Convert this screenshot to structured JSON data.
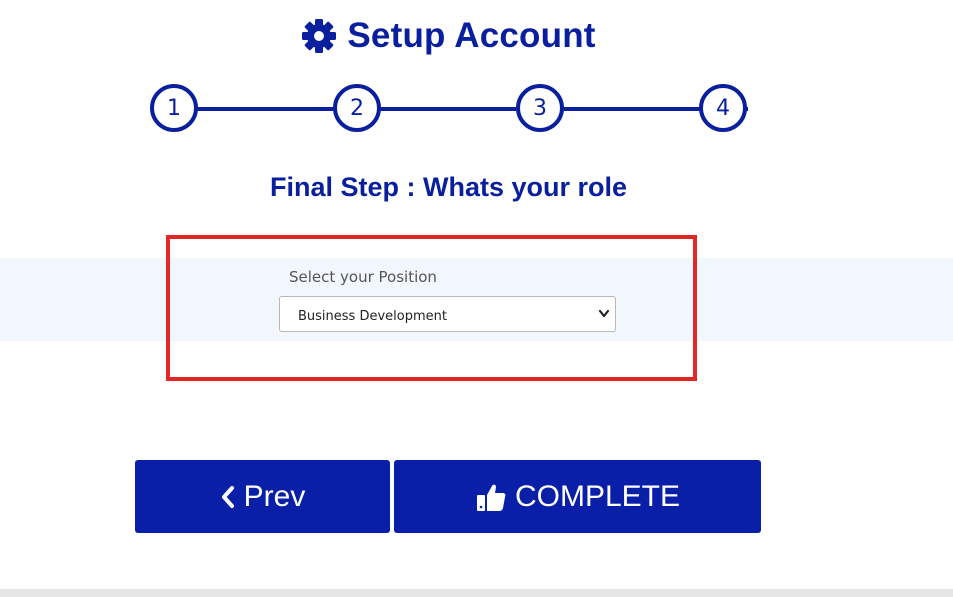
{
  "header": {
    "title": "Setup Account",
    "icon": "gear-icon"
  },
  "stepper": {
    "steps": [
      "1",
      "2",
      "3",
      "4"
    ]
  },
  "subtitle": "Final Step : Whats your role",
  "position_field": {
    "label": "Select your Position",
    "selected_value": "Business Development"
  },
  "buttons": {
    "prev_label": "Prev",
    "complete_label": "COMPLETE"
  },
  "colors": {
    "primary": "#0a1fa8",
    "highlight": "#e32626",
    "band": "#f2f6fd"
  }
}
